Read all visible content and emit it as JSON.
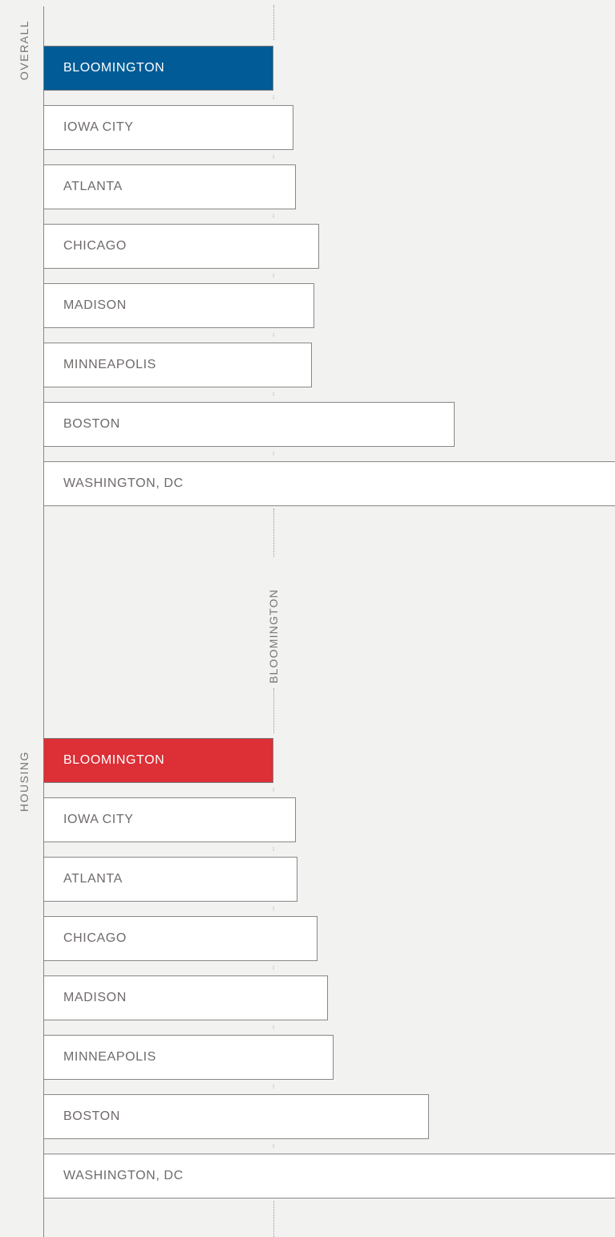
{
  "chart_data": {
    "type": "bar",
    "orientation": "horizontal",
    "reference_label": "BLOOMINGTON",
    "groups": [
      {
        "name": "OVERALL",
        "highlight_color": "#005b96",
        "categories": [
          "BLOOMINGTON",
          "IOWA CITY",
          "ATLANTA",
          "CHICAGO",
          "MADISON",
          "MINNEAPOLIS",
          "BOSTON",
          "WASHINGTON, DC"
        ],
        "values": [
          100,
          108.8,
          109.8,
          119.9,
          117.8,
          116.8,
          178.7,
          250.3
        ]
      },
      {
        "name": "HOUSING",
        "highlight_color": "#dc2f36",
        "categories": [
          "BLOOMINGTON",
          "IOWA CITY",
          "ATLANTA",
          "CHICAGO",
          "MADISON",
          "MINNEAPOLIS",
          "BOSTON",
          "WASHINGTON, DC"
        ],
        "values": [
          100,
          109.8,
          110.5,
          119.2,
          123.8,
          126.3,
          167.5,
          250.3
        ]
      }
    ]
  }
}
